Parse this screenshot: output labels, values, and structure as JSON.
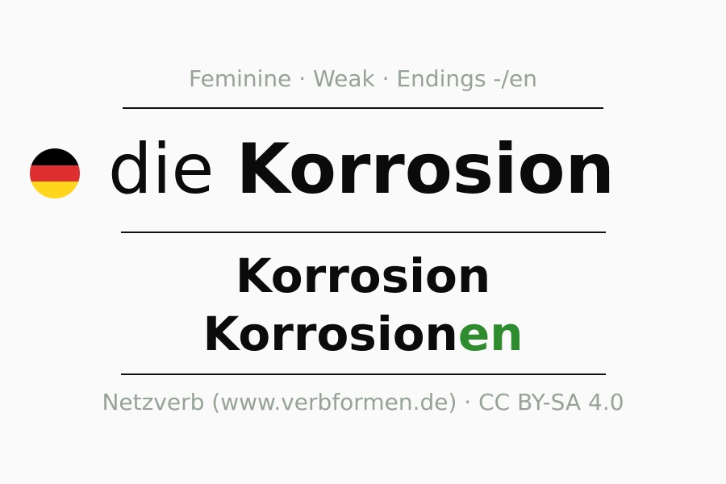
{
  "subtitle": "Feminine · Weak · Endings -/en",
  "flag": {
    "icon": "german-flag-icon",
    "colors": [
      "#000000",
      "#dd2f2f",
      "#ffd51e"
    ]
  },
  "headline": {
    "article": "die",
    "noun": "Korrosion"
  },
  "forms": {
    "singular": "Korrosion",
    "plural_stem": "Korrosion",
    "plural_ending": "en"
  },
  "footer": "Netzverb (www.verbformen.de) · CC BY-SA 4.0",
  "colors": {
    "ending": "#2e8b2e",
    "muted_text": "#97a397",
    "text": "#0b0b0b",
    "background": "#fafafa"
  }
}
